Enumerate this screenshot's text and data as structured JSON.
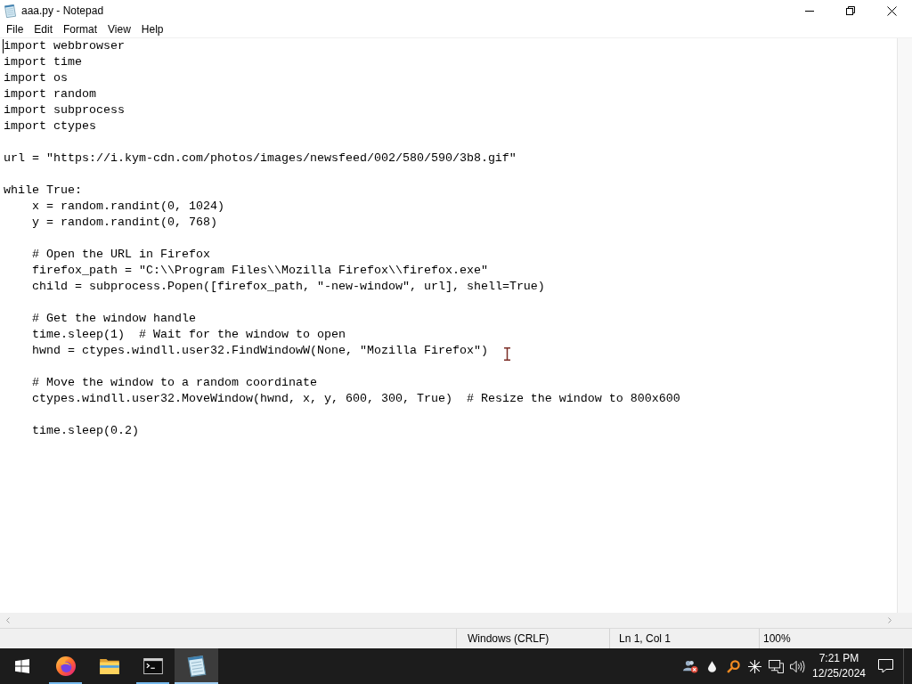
{
  "window": {
    "title": "aaa.py - Notepad"
  },
  "menu": [
    "File",
    "Edit",
    "Format",
    "View",
    "Help"
  ],
  "editor": {
    "blocks": [
      {
        "lines": [
          {
            "text": "import webbrowser"
          },
          {
            "text": "import time"
          },
          {
            "text": "import os"
          },
          {
            "text": "import random"
          },
          {
            "text": "import subprocess"
          },
          {
            "text": "import ctypes"
          }
        ]
      },
      {
        "lines": [
          {
            "text": "url = \"https://i.kym-cdn.com/photos/images/newsfeed/002/580/590/3b8.gif\""
          }
        ]
      },
      {
        "lines": [
          {
            "text": "while True:",
            "children": [
              {
                "lines": [
                  {
                    "text": "x = random.randint(0, 1024)"
                  },
                  {
                    "text": "y = random.randint(0, 768)"
                  }
                ]
              },
              {
                "lines": [
                  {
                    "text": "# Open the URL in Firefox"
                  },
                  {
                    "text": "firefox_path = \"C:\\\\Program Files\\\\Mozilla Firefox\\\\firefox.exe\""
                  },
                  {
                    "text": "child = subprocess.Popen([firefox_path, \"-new-window\", url], shell=True)"
                  }
                ]
              },
              {
                "lines": [
                  {
                    "text": "# Get the window handle"
                  },
                  {
                    "text": "time.sleep(1)  # Wait for the window to open"
                  },
                  {
                    "text": "hwnd = ctypes.windll.user32.FindWindowW(None, \"Mozilla Firefox\")"
                  }
                ]
              },
              {
                "lines": [
                  {
                    "text": "# Move the window to a random coordinate"
                  },
                  {
                    "text": "ctypes.windll.user32.MoveWindow(hwnd, x, y, 600, 300, True)  # Resize the window to 800x600"
                  }
                ]
              },
              {
                "lines": [
                  {
                    "text": "time.sleep(0.2)"
                  }
                ]
              }
            ]
          }
        ]
      }
    ]
  },
  "status_bar": {
    "line_ending": "Windows (CRLF)",
    "position": "Ln 1, Col 1",
    "zoom": "100%"
  },
  "taskbar": {
    "apps": [
      {
        "kind": "firefox",
        "running": true,
        "selected": false
      },
      {
        "kind": "folder",
        "running": false,
        "selected": false
      },
      {
        "kind": "terminal",
        "running": true,
        "selected": false
      },
      {
        "kind": "notepad",
        "running": true,
        "selected": true
      }
    ],
    "clock": {
      "time": "7:21 PM",
      "date": "12/25/2024"
    }
  }
}
